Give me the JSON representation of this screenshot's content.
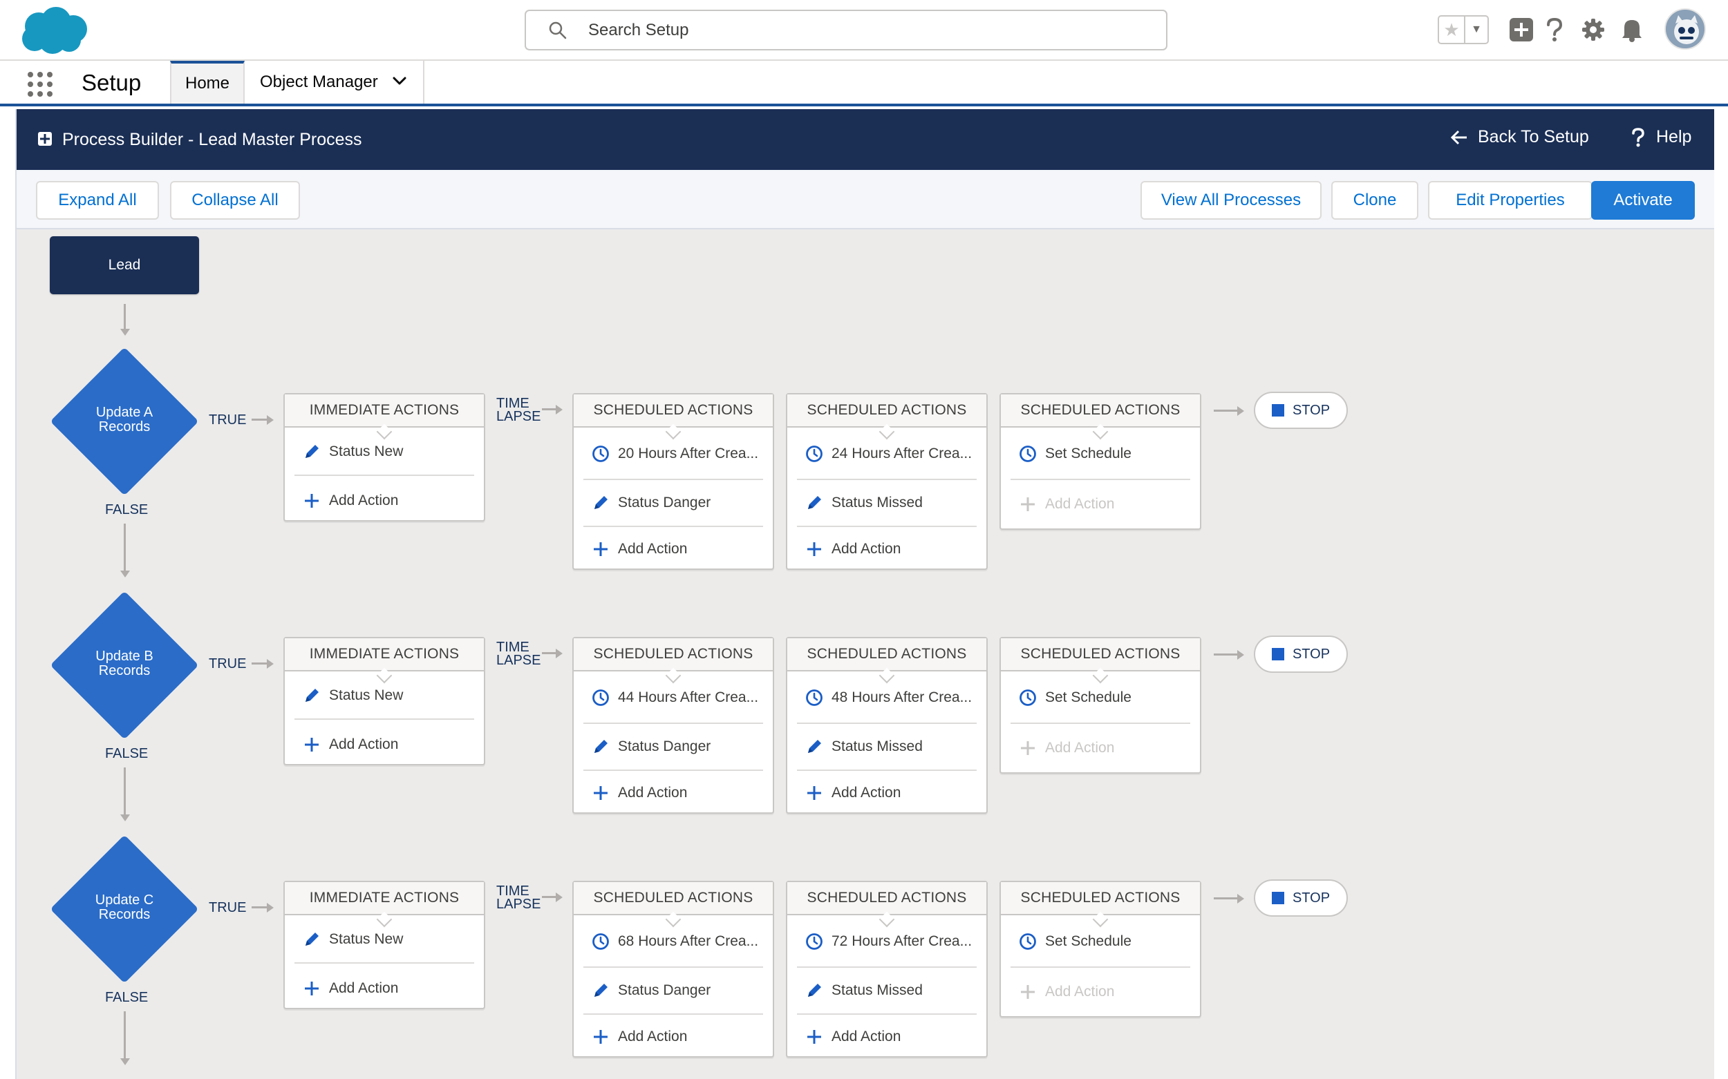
{
  "header": {
    "search_placeholder": "Search Setup"
  },
  "nav": {
    "app_name": "Setup",
    "tabs": [
      {
        "label": "Home"
      },
      {
        "label": "Object Manager"
      }
    ]
  },
  "pb": {
    "title": "Process Builder - Lead Master Process",
    "back_label": "Back To Setup",
    "help_label": "Help"
  },
  "toolbar": {
    "expand_all": "Expand All",
    "collapse_all": "Collapse All",
    "view_all": "View All Processes",
    "clone": "Clone",
    "edit_properties": "Edit Properties",
    "activate": "Activate"
  },
  "canvas": {
    "start_node": "Lead",
    "labels": {
      "true": "TRUE",
      "false": "FALSE",
      "time": "TIME",
      "lapse": "LAPSE",
      "immediate": "IMMEDIATE ACTIONS",
      "scheduled": "SCHEDULED ACTIONS",
      "add_action": "Add Action",
      "stop": "STOP",
      "set_schedule": "Set Schedule"
    },
    "criteria": [
      {
        "line1": "Update A",
        "line2": "Records",
        "immediate_action": "Status New",
        "sched1_time": "20 Hours After Crea...",
        "sched1_action": "Status Danger",
        "sched2_time": "24 Hours After Crea...",
        "sched2_action": "Status Missed"
      },
      {
        "line1": "Update B",
        "line2": "Records",
        "immediate_action": "Status New",
        "sched1_time": "44 Hours After Crea...",
        "sched1_action": "Status Danger",
        "sched2_time": "48 Hours After Crea...",
        "sched2_action": "Status Missed"
      },
      {
        "line1": "Update C",
        "line2": "Records",
        "immediate_action": "Status New",
        "sched1_time": "68 Hours After Crea...",
        "sched1_action": "Status Danger",
        "sched2_time": "72 Hours After Crea...",
        "sched2_action": "Status Missed"
      }
    ]
  },
  "colors": {
    "brand_blue": "#1b5297",
    "header_navy": "#1b2f55",
    "diamond_blue": "#2a6cc8",
    "link_blue": "#0070d2"
  }
}
